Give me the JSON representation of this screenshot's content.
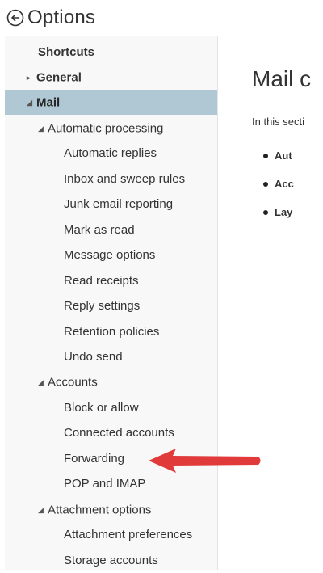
{
  "header": {
    "title": "Options",
    "back_icon": "back-arrow-circle-icon"
  },
  "sidebar": {
    "shortcuts": "Shortcuts",
    "general": "General",
    "mail": "Mail",
    "automatic_processing": {
      "label": "Automatic processing",
      "items": [
        "Automatic replies",
        "Inbox and sweep rules",
        "Junk email reporting",
        "Mark as read",
        "Message options",
        "Read receipts",
        "Reply settings",
        "Retention policies",
        "Undo send"
      ]
    },
    "accounts": {
      "label": "Accounts",
      "items": [
        "Block or allow",
        "Connected accounts",
        "Forwarding",
        "POP and IMAP"
      ]
    },
    "attachment_options": {
      "label": "Attachment options",
      "items": [
        "Attachment preferences",
        "Storage accounts"
      ]
    }
  },
  "main": {
    "title": "Mail c",
    "intro": "In this secti",
    "bullets": [
      "Aut",
      "Acc",
      "Lay"
    ]
  },
  "colors": {
    "selected_bg": "#b0c8d4",
    "sidebar_bg": "#f8f8f8",
    "annotation_arrow": "#e03a3a"
  }
}
